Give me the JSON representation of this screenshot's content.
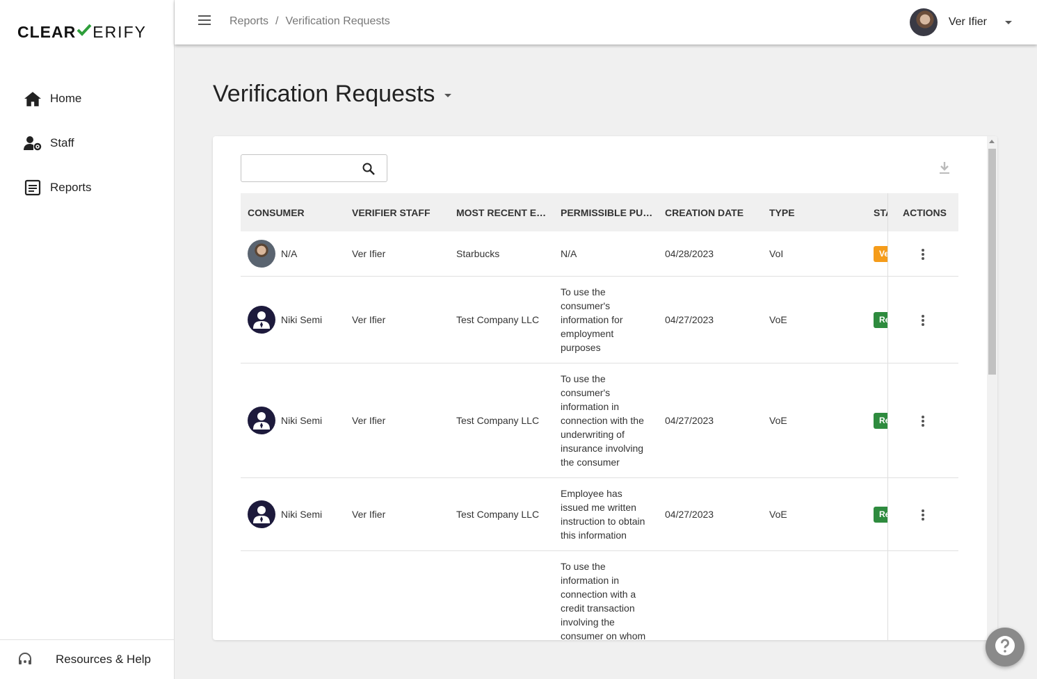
{
  "brand": {
    "part1": "CLEAR",
    "part2": "ERIFY"
  },
  "sidebar": {
    "items": [
      {
        "label": "Home",
        "icon": "home-icon"
      },
      {
        "label": "Staff",
        "icon": "staff-settings-icon"
      },
      {
        "label": "Reports",
        "icon": "reports-icon"
      }
    ],
    "bottom": {
      "label": "Resources & Help",
      "icon": "support-headset-icon"
    }
  },
  "breadcrumb": {
    "root": "Reports",
    "separator": "/",
    "current": "Verification Requests"
  },
  "user": {
    "name": "Ver Ifier"
  },
  "page": {
    "title": "Verification Requests"
  },
  "search": {
    "value": "",
    "placeholder": ""
  },
  "table": {
    "headers": [
      "CONSUMER",
      "VERIFIER STAFF",
      "MOST RECENT EMP...",
      "PERMISSIBLE PURP...",
      "CREATION DATE",
      "TYPE",
      "STA",
      "ACTIONS"
    ],
    "rows": [
      {
        "consumer": "N/A",
        "avatar": "photo",
        "staff": "Ver Ifier",
        "employer": "Starbucks",
        "purpose": "N/A",
        "date": "04/28/2023",
        "type": "VoI",
        "status": "Ve",
        "status_color": "#f59c1a"
      },
      {
        "consumer": "Niki Semi",
        "avatar": "icon",
        "staff": "Ver Ifier",
        "employer": "Test Company LLC",
        "purpose": "To use the consumer's information for employment purposes",
        "date": "04/27/2023",
        "type": "VoE",
        "status": "Re",
        "status_color": "#2e8b3e"
      },
      {
        "consumer": "Niki Semi",
        "avatar": "icon",
        "staff": "Ver Ifier",
        "employer": "Test Company LLC",
        "purpose": "To use the consumer's information in connection with the underwriting of insurance involving the consumer",
        "date": "04/27/2023",
        "type": "VoE",
        "status": "Re",
        "status_color": "#2e8b3e"
      },
      {
        "consumer": "Niki Semi",
        "avatar": "icon",
        "staff": "Ver Ifier",
        "employer": "Test Company LLC",
        "purpose": "Employee has issued me written instruction to obtain this information",
        "date": "04/27/2023",
        "type": "VoE",
        "status": "Re",
        "status_color": "#2e8b3e"
      },
      {
        "purpose": "To use the information in connection with a credit transaction involving the consumer on whom"
      }
    ]
  },
  "colors": {
    "brand_check": "#2e9e3a",
    "avatar_dark": "#1d1a3c"
  }
}
